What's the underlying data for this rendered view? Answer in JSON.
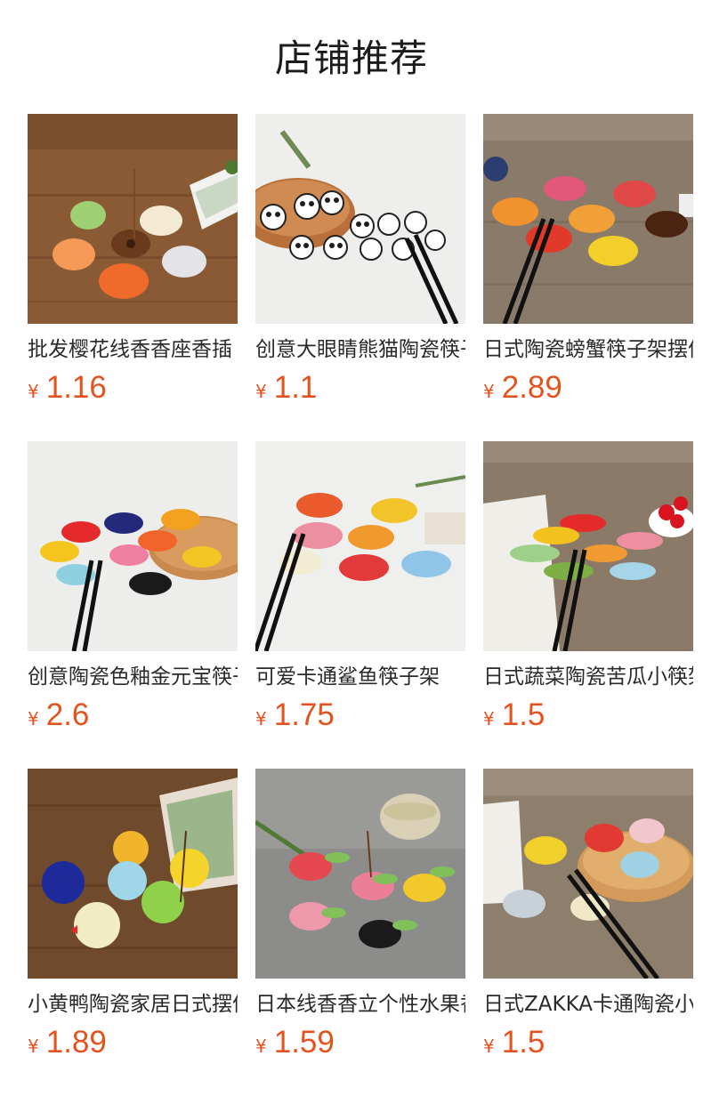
{
  "title": "店铺推荐",
  "currency_symbol": "¥",
  "products": [
    {
      "name": "批发樱花线香香座香插",
      "price": "1.16",
      "image": "cherry-blossom-incense-holders"
    },
    {
      "name": "创意大眼睛熊猫陶瓷筷子架",
      "price": "1.1",
      "image": "panda-chopstick-rests"
    },
    {
      "name": "日式陶瓷螃蟹筷子架摆件",
      "price": "2.89",
      "image": "crab-chopstick-rests"
    },
    {
      "name": "创意陶瓷色釉金元宝筷子架",
      "price": "2.6",
      "image": "gold-ingot-chopstick-rests"
    },
    {
      "name": "可爱卡通鲨鱼筷子架",
      "price": "1.75",
      "image": "shark-chopstick-rests"
    },
    {
      "name": "日式蔬菜陶瓷苦瓜小筷架",
      "price": "1.5",
      "image": "vegetable-chopstick-rests"
    },
    {
      "name": "小黄鸭陶瓷家居日式摆件",
      "price": "1.89",
      "image": "duck-incense-holders"
    },
    {
      "name": "日本线香香立个性水果香插",
      "price": "1.59",
      "image": "fruit-incense-holders"
    },
    {
      "name": "日式ZAKKA卡通陶瓷小鸟筷架",
      "price": "1.5",
      "image": "bird-chopstick-rests"
    }
  ]
}
